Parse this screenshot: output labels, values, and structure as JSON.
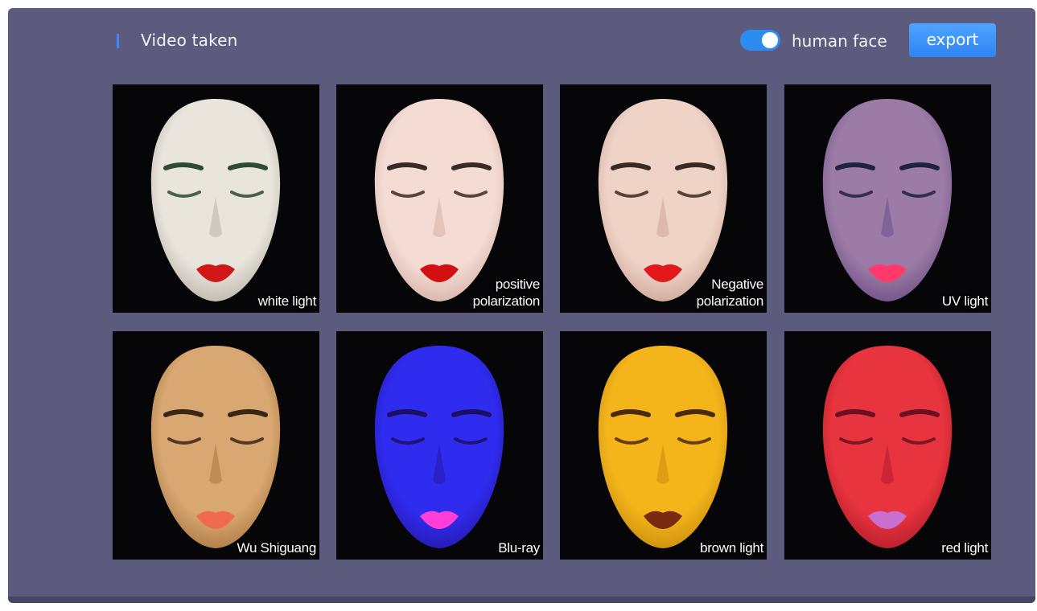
{
  "header": {
    "title": "Video taken",
    "toggle_label": "human face",
    "toggle_on": true,
    "export_label": "export"
  },
  "tiles": [
    {
      "caption": "white light",
      "face_color": "#e9e4dc",
      "shade_color": "#b9b2a8",
      "lip_color": "#d01818",
      "brow_color": "#2c4a36"
    },
    {
      "caption": "positive\npolarization",
      "face_color": "#f4dcd4",
      "shade_color": "#d4b0a6",
      "lip_color": "#d40f10",
      "brow_color": "#3a2a26"
    },
    {
      "caption": "Negative\npolarization",
      "face_color": "#efd3c7",
      "shade_color": "#cca597",
      "lip_color": "#e2181a",
      "brow_color": "#3a2a26"
    },
    {
      "caption": "UV light",
      "face_color": "#9c7ca6",
      "shade_color": "#6e4e86",
      "lip_color": "#ff3a6a",
      "brow_color": "#1e2440"
    },
    {
      "caption": "Wu Shiguang",
      "face_color": "#d9a772",
      "shade_color": "#a8763f",
      "lip_color": "#f06a52",
      "brow_color": "#3a2616"
    },
    {
      "caption": "Blu-ray",
      "face_color": "#2f2cf0",
      "shade_color": "#2418a8",
      "lip_color": "#ff3fd8",
      "brow_color": "#1a1060"
    },
    {
      "caption": "brown light",
      "face_color": "#f3b51a",
      "shade_color": "#c98a0c",
      "lip_color": "#7a2a10",
      "brow_color": "#4a2a0a"
    },
    {
      "caption": "red light",
      "face_color": "#e8343e",
      "shade_color": "#b01c2a",
      "lip_color": "#c86fd0",
      "brow_color": "#6a1020"
    }
  ]
}
